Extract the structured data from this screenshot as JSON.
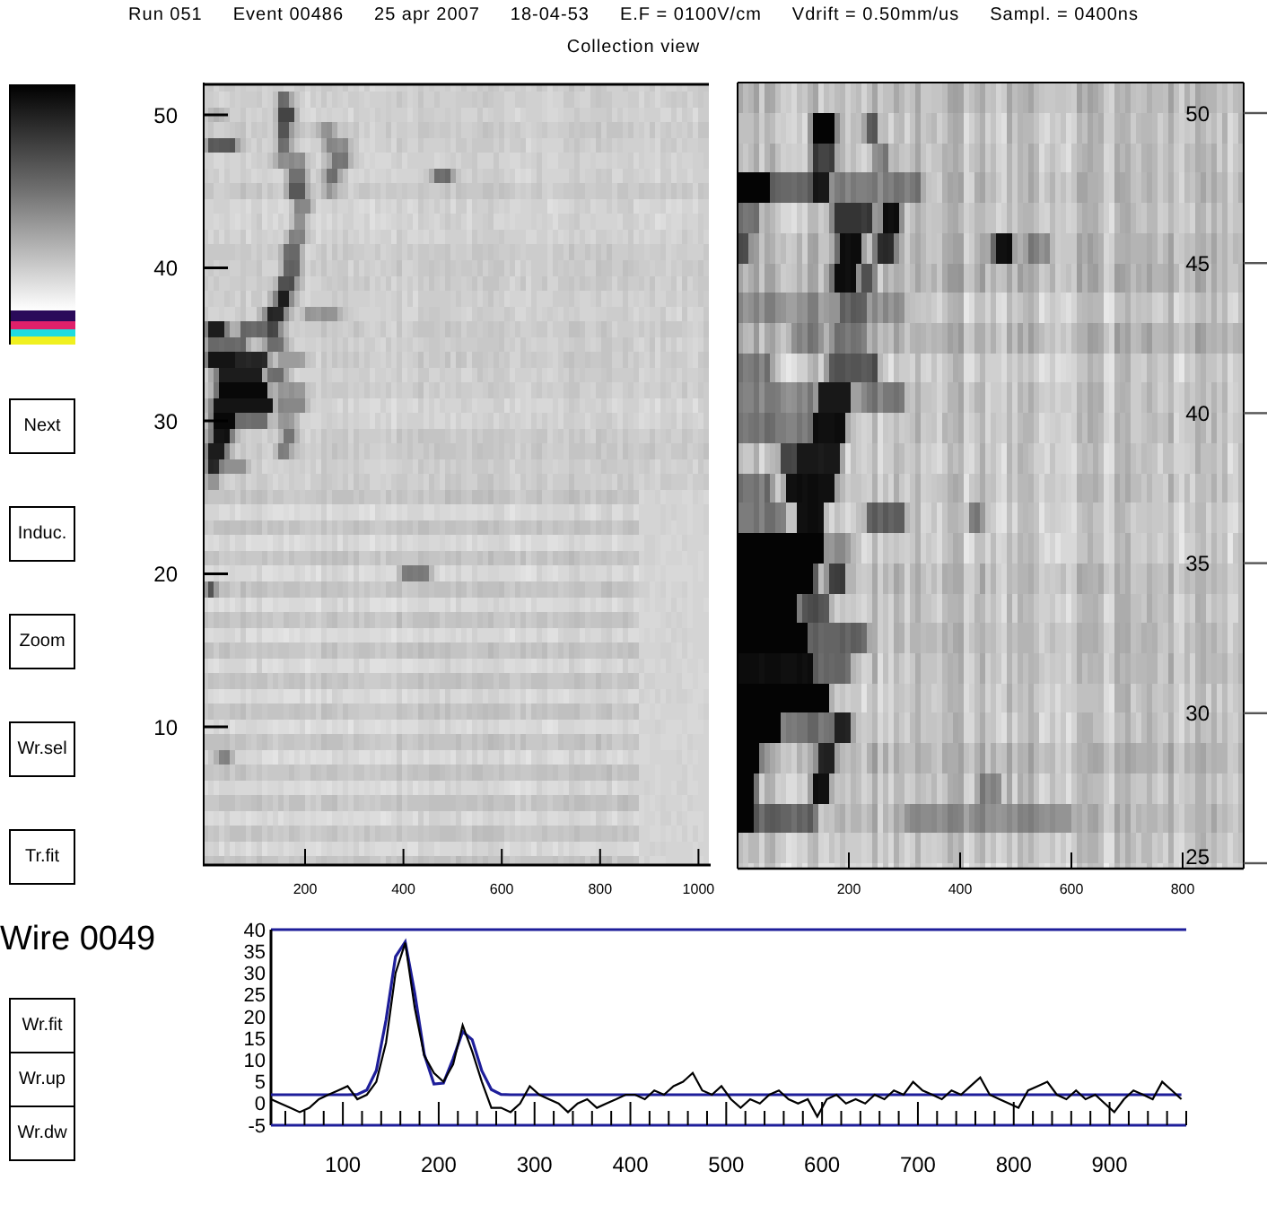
{
  "header": {
    "run_info": [
      "Run 051",
      "Event 00486",
      "25 apr 2007",
      "18-04-53",
      "E.F = 0100V/cm",
      "Vdrift = 0.50mm/us",
      "Sampl. = 0400ns"
    ],
    "view_title": "Collection view"
  },
  "sidebar": {
    "buttons": [
      "Next",
      "Induc.",
      "Zoom",
      "Wr.sel",
      "Tr.fit"
    ]
  },
  "left_map": {
    "y_ticks": [
      "50",
      "40",
      "30",
      "20",
      "10"
    ],
    "x_ticks": [
      "200",
      "400",
      "600",
      "800",
      "1000"
    ]
  },
  "right_map": {
    "y_ticks": [
      "50",
      "45",
      "40",
      "35",
      "30",
      "25"
    ],
    "x_ticks": [
      "200",
      "400",
      "600",
      "800"
    ]
  },
  "wire_panel": {
    "title": "Wire 0049",
    "buttons": [
      "Wr.fit",
      "Wr.up",
      "Wr.dw"
    ],
    "chart_data": {
      "type": "line",
      "x": [
        25,
        35,
        45,
        55,
        65,
        75,
        85,
        95,
        105,
        115,
        125,
        135,
        145,
        155,
        165,
        175,
        185,
        195,
        205,
        215,
        225,
        235,
        245,
        255,
        265,
        275,
        285,
        295,
        305,
        315,
        325,
        335,
        345,
        355,
        365,
        375,
        385,
        395,
        405,
        415,
        425,
        435,
        445,
        455,
        465,
        475,
        485,
        495,
        505,
        515,
        525,
        535,
        545,
        555,
        565,
        575,
        585,
        595,
        605,
        615,
        625,
        635,
        645,
        655,
        665,
        675,
        685,
        695,
        705,
        715,
        725,
        735,
        745,
        755,
        765,
        775,
        785,
        795,
        805,
        815,
        825,
        835,
        845,
        855,
        865,
        875,
        885,
        895,
        905,
        915,
        925,
        935,
        945,
        955,
        965,
        975
      ],
      "series": [
        {
          "color": "#1e1e9a",
          "values": [
            2,
            2,
            2,
            2,
            2,
            2,
            2,
            2,
            2,
            2.1,
            3.1,
            7.6,
            19.2,
            33.8,
            37.2,
            25.4,
            11.3,
            4.5,
            4.7,
            10.3,
            16.5,
            14.7,
            7.5,
            3.2,
            2.1,
            2,
            2,
            2,
            2,
            2,
            2,
            2,
            2,
            2,
            2,
            2,
            2,
            2,
            2,
            2,
            2,
            2,
            2,
            2,
            2,
            2,
            2,
            2,
            2,
            2,
            2,
            2,
            2,
            2,
            2,
            2,
            2,
            2,
            2,
            2,
            2,
            2,
            2,
            2,
            2,
            2,
            2,
            2,
            2,
            2,
            2,
            2,
            2,
            2,
            2,
            2,
            2,
            2,
            2,
            2,
            2,
            2,
            2,
            2,
            2,
            2,
            2,
            2,
            2,
            2,
            2,
            2,
            2,
            2,
            2,
            2
          ]
        },
        {
          "color": "#000000",
          "values": [
            1,
            0,
            -1,
            -2,
            -1,
            1,
            2,
            3,
            4,
            1,
            2,
            5,
            14,
            30,
            37,
            22,
            11,
            7,
            5,
            9,
            18,
            12,
            5,
            -1,
            -1,
            -2,
            0,
            4,
            2,
            1,
            0,
            -2,
            0,
            1,
            -1,
            0,
            1,
            2,
            2,
            1,
            3,
            2,
            4,
            5,
            7,
            3,
            2,
            4,
            1,
            -1,
            1,
            0,
            2,
            3,
            1,
            0,
            1,
            -3,
            1,
            2,
            0,
            1,
            0,
            2,
            1,
            3,
            2,
            5,
            3,
            2,
            1,
            3,
            2,
            4,
            6,
            2,
            1,
            0,
            -1,
            3,
            4,
            5,
            2,
            1,
            3,
            1,
            2,
            0,
            -2,
            1,
            3,
            2,
            1,
            5,
            3,
            1
          ]
        }
      ],
      "xlim": [
        25,
        980
      ],
      "ylim": [
        -5,
        40
      ],
      "xticks": [
        100,
        200,
        300,
        400,
        500,
        600,
        700,
        800,
        900
      ],
      "yticks": [
        -5,
        0,
        5,
        10,
        15,
        20,
        25,
        30,
        35,
        40
      ]
    }
  }
}
